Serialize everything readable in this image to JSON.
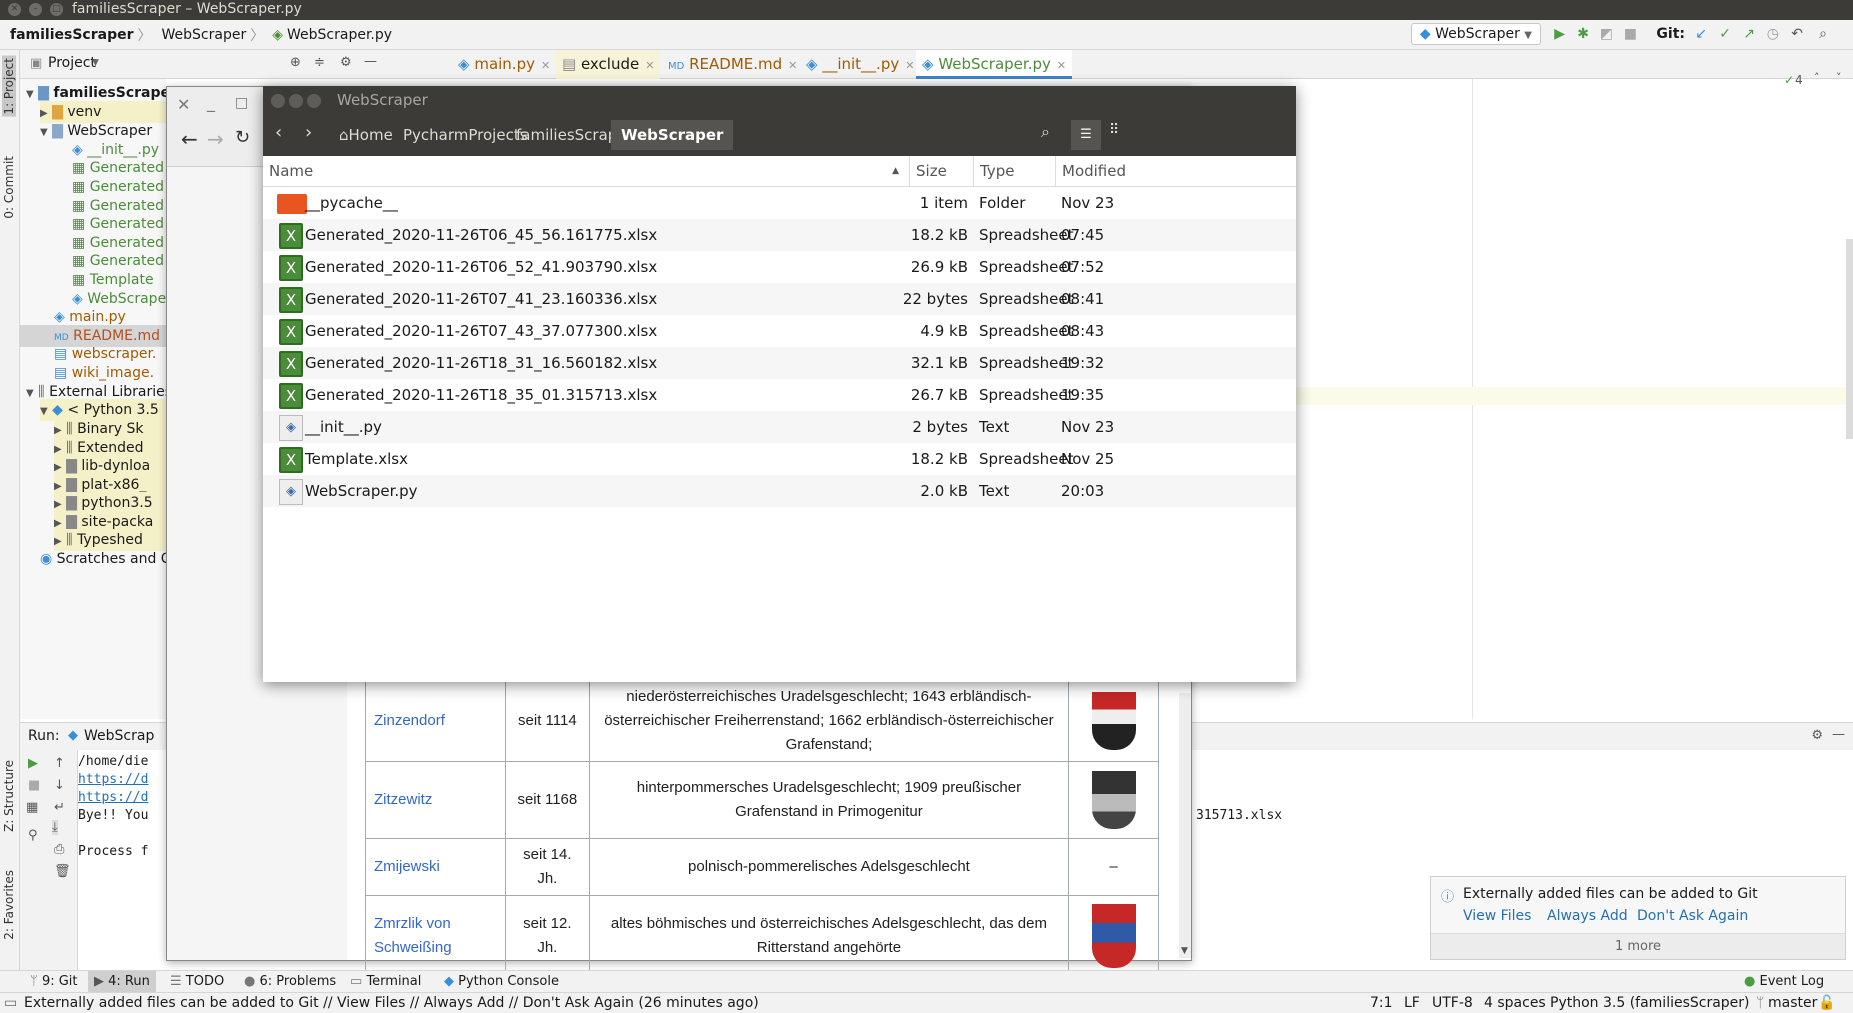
{
  "window": {
    "title": "familiesScraper – WebScraper.py"
  },
  "navbar": {
    "crumbs": [
      "familiesScraper",
      "WebScraper",
      "WebScraper.py"
    ],
    "run_config": "WebScraper",
    "git_label": "Git:"
  },
  "left_stripe": {
    "project": "1: Project",
    "commit": "0: Commit",
    "structure": "Z: Structure",
    "favorites": "2: Favorites"
  },
  "project_panel": {
    "title": "Project",
    "tree": [
      "familiesScraper",
      "venv",
      "WebScraper",
      "__init__.py",
      "Generated",
      "Generated",
      "Generated",
      "Generated",
      "Generated",
      "Generated",
      "Template",
      "WebScraper",
      "main.py",
      "README.md",
      "webscraper.",
      "wiki_image.",
      "External Libraries",
      "< Python 3.5",
      "Binary Sk",
      "Extended",
      "lib-dynloa",
      "plat-x86_",
      "python3.5",
      "site-packa",
      "Typeshed",
      "Scratches and C"
    ]
  },
  "editor_tabs": [
    {
      "label": "main.py"
    },
    {
      "label": "exclude"
    },
    {
      "label": "README.md"
    },
    {
      "label": "__init__.py"
    },
    {
      "label": "WebScraper.py"
    }
  ],
  "editor": {
    "inspection_count": "4"
  },
  "run_panel": {
    "label": "Run:",
    "config": "WebScrap",
    "lines": [
      "/home/die",
      "https://d",
      "https://d",
      "Bye!! You",
      "",
      "Process f"
    ],
    "tail_text": "315713.xlsx"
  },
  "file_manager": {
    "title": "WebScraper",
    "path": [
      "Home",
      "PycharmProjects",
      "familiesScraper",
      "WebScraper"
    ],
    "columns": [
      "Name",
      "Size",
      "Type",
      "Modified"
    ],
    "files": [
      {
        "name": "__pycache__",
        "size": "1 item",
        "type": "Folder",
        "modified": "Nov 23",
        "icon": "folder-icon"
      },
      {
        "name": "Generated_2020-11-26T06_45_56.161775.xlsx",
        "size": "18.2 kB",
        "type": "Spreadsheet",
        "modified": "07:45",
        "icon": "spreadsheet-icon"
      },
      {
        "name": "Generated_2020-11-26T06_52_41.903790.xlsx",
        "size": "26.9 kB",
        "type": "Spreadsheet",
        "modified": "07:52",
        "icon": "spreadsheet-icon"
      },
      {
        "name": "Generated_2020-11-26T07_41_23.160336.xlsx",
        "size": "22 bytes",
        "type": "Spreadsheet",
        "modified": "08:41",
        "icon": "spreadsheet-icon"
      },
      {
        "name": "Generated_2020-11-26T07_43_37.077300.xlsx",
        "size": "4.9 kB",
        "type": "Spreadsheet",
        "modified": "08:43",
        "icon": "spreadsheet-icon"
      },
      {
        "name": "Generated_2020-11-26T18_31_16.560182.xlsx",
        "size": "32.1 kB",
        "type": "Spreadsheet",
        "modified": "19:32",
        "icon": "spreadsheet-icon"
      },
      {
        "name": "Generated_2020-11-26T18_35_01.315713.xlsx",
        "size": "26.7 kB",
        "type": "Spreadsheet",
        "modified": "19:35",
        "icon": "spreadsheet-icon"
      },
      {
        "name": "__init__.py",
        "size": "2 bytes",
        "type": "Text",
        "modified": "Nov 23",
        "icon": "python-file-icon"
      },
      {
        "name": "Template.xlsx",
        "size": "18.2 kB",
        "type": "Spreadsheet",
        "modified": "Nov 25",
        "icon": "spreadsheet-icon"
      },
      {
        "name": "WebScraper.py",
        "size": "2.0 kB",
        "type": "Text",
        "modified": "20:03",
        "icon": "python-file-icon"
      }
    ]
  },
  "wiki_table": [
    {
      "name": "Zinzendorf",
      "since": "seit 1114",
      "desc": "niederösterreichisches Uradelsgeschlecht; 1643 erbländisch-österreichischer Freiherrenstand; 1662 erbländisch-österreichischer Grafenstand;"
    },
    {
      "name": "Zitzewitz",
      "since": "seit 1168",
      "desc": "hinterpommersches Uradelsgeschlecht; 1909 preußischer Grafenstand in Primogenitur"
    },
    {
      "name": "Zmijewski",
      "since": "seit 14. Jh.",
      "desc": "polnisch-pommerelisches Adelsgeschlecht",
      "coa": "–"
    },
    {
      "name": "Zmrzlik von Schweißing",
      "since": "seit 12. Jh.",
      "desc": "altes böhmisches und österreichisches Adelsgeschlecht, das dem Ritterstand angehörte"
    }
  ],
  "notification": {
    "message": "Externally added files can be added to Git",
    "actions": [
      "View Files",
      "Always Add",
      "Don't Ask Again"
    ],
    "more": "1 more"
  },
  "bottom_tools": [
    "9: Git",
    "4: Run",
    "TODO",
    "6: Problems",
    "Terminal",
    "Python Console",
    "Event Log"
  ],
  "status": {
    "message": "Externally added files can be added to Git // View Files // Always Add // Don't Ask Again (26 minutes ago)",
    "position": "7:1",
    "line_sep": "LF",
    "encoding": "UTF-8",
    "indent": "4 spaces",
    "interpreter": "Python 3.5 (familiesScraper)",
    "branch": "master"
  },
  "colors": {
    "accent": "#e95420",
    "link": "#2470b3",
    "dark_header": "#3c3b37"
  }
}
